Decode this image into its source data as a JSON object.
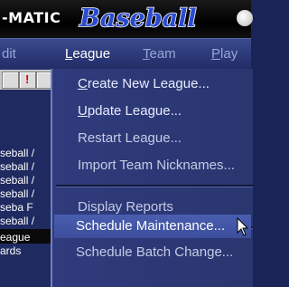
{
  "banner": {
    "left_text": "-MATIC",
    "logo_text": "Baseball",
    "ball_icon": "baseball-icon"
  },
  "menubar": {
    "items": [
      {
        "label": "dit",
        "underline": ""
      },
      {
        "label": "eague",
        "underline": "L"
      },
      {
        "label": "eam",
        "underline": "T"
      },
      {
        "label": "lay",
        "underline": "P"
      }
    ]
  },
  "toolbar": {
    "buttons": [
      "!",
      "!"
    ]
  },
  "left_list": {
    "rows": [
      "seball /",
      "seball /",
      "seball /",
      "seball /",
      "seba F",
      "seball /",
      "eague",
      "ards"
    ]
  },
  "league_menu": {
    "items": [
      {
        "pre": "",
        "key": "C",
        "post": "reate New League..."
      },
      {
        "pre": "",
        "key": "U",
        "post": "pdate League..."
      },
      {
        "pre": "",
        "key": "",
        "post": "Restart League..."
      },
      {
        "pre": "",
        "key": "",
        "post": "Import Team Nicknames..."
      },
      {
        "pre": "",
        "key": "",
        "post": "Display Reports"
      },
      {
        "pre": "",
        "key": "",
        "post": "Schedule Maintenance..."
      },
      {
        "pre": "",
        "key": "",
        "post": "Schedule Batch Change..."
      }
    ]
  },
  "colors": {
    "menubar": "#2b3776",
    "dropdown": "#2f3b7c",
    "highlight": "#4a5eb0"
  }
}
